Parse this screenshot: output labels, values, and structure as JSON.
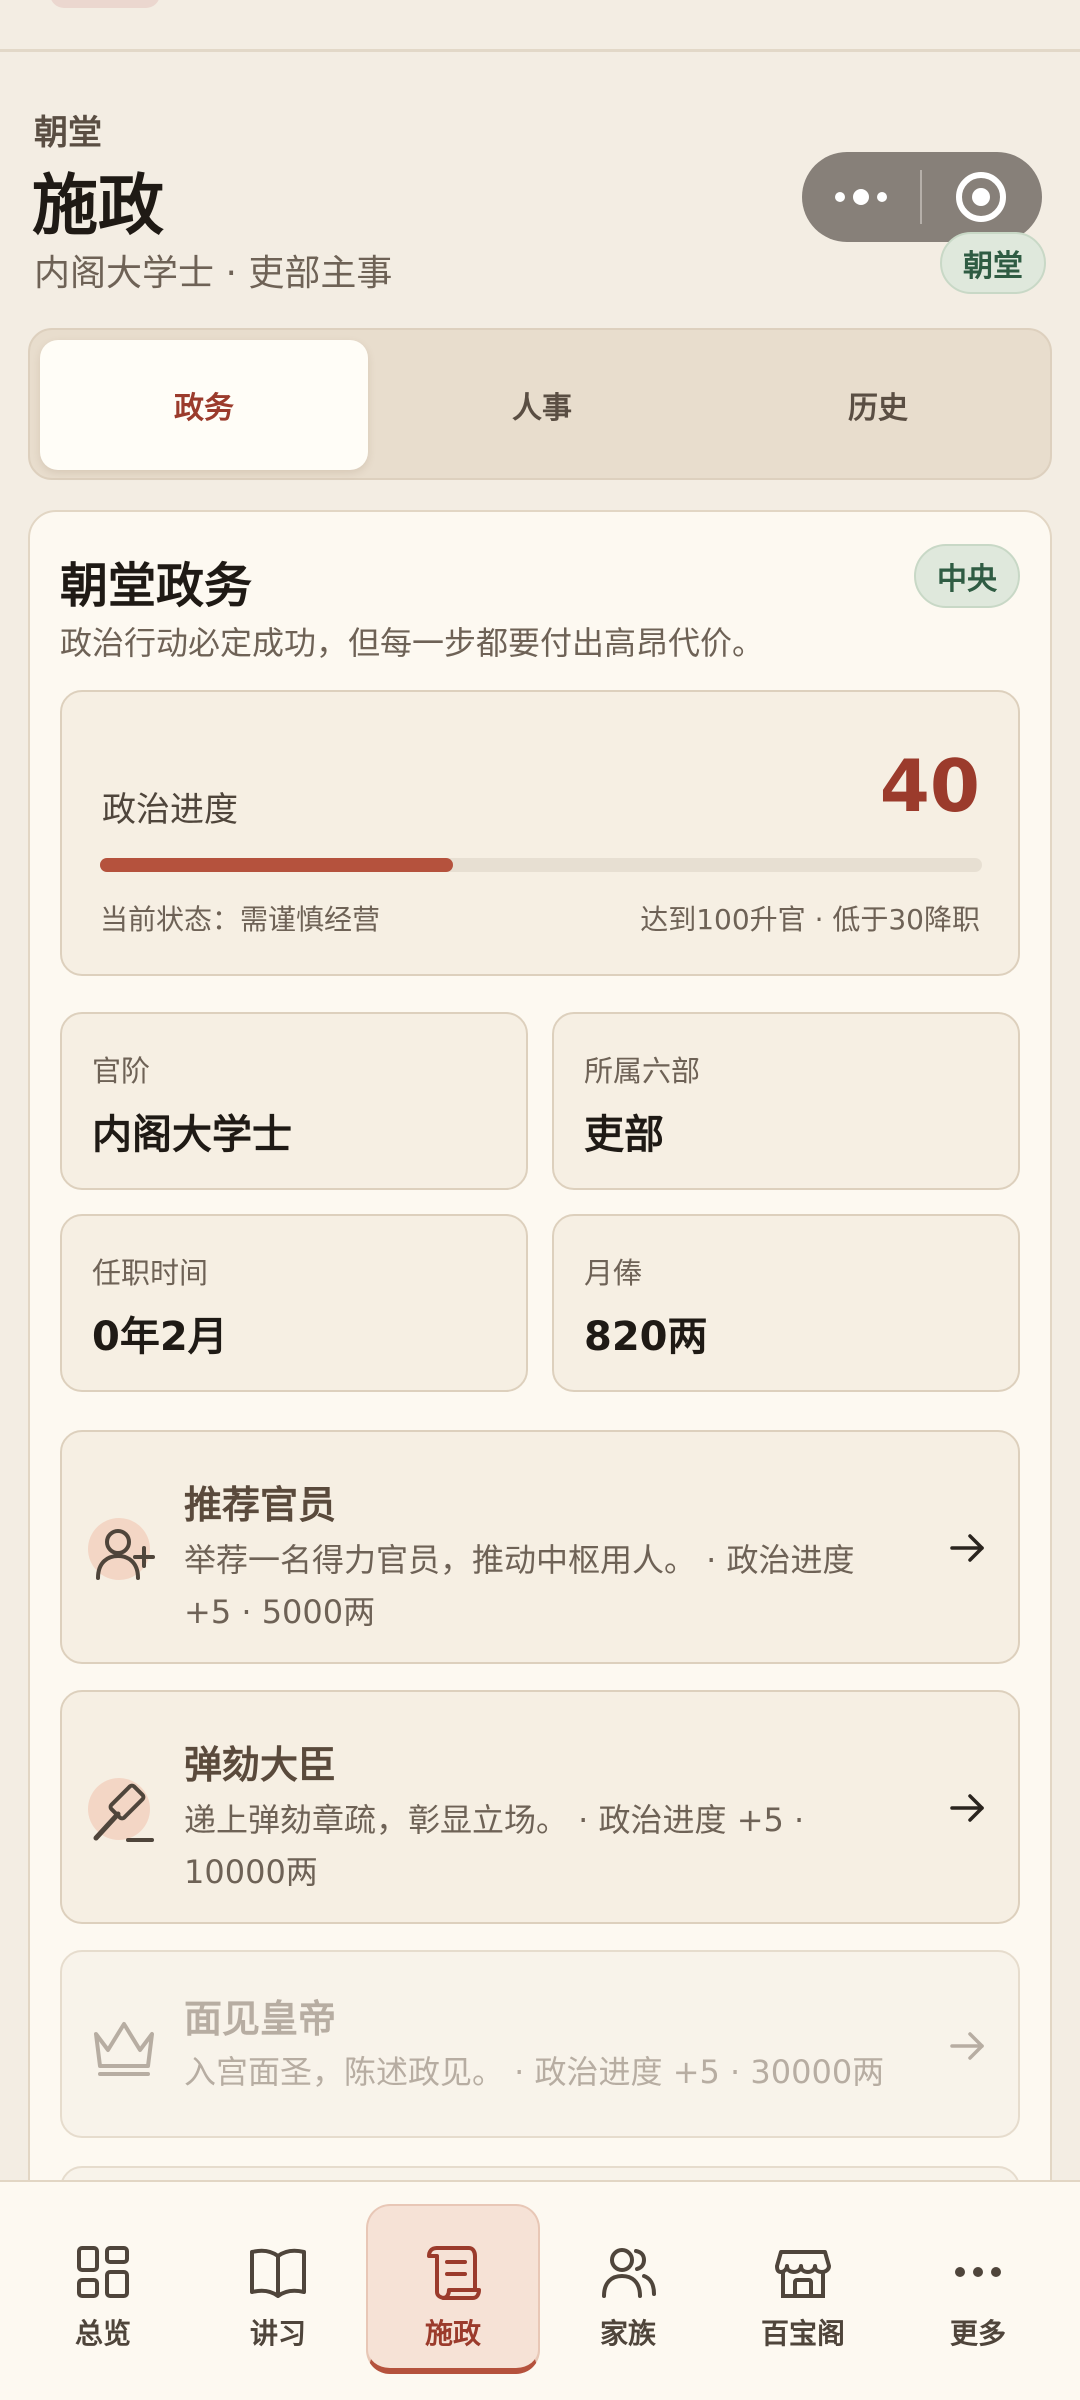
{
  "header": {
    "kicker": "朝堂",
    "title": "施政",
    "subtitle": "内阁大学士 · 吏部主事",
    "badge": "朝堂"
  },
  "tabs": [
    {
      "label": "政务",
      "active": true
    },
    {
      "label": "人事",
      "active": false
    },
    {
      "label": "历史",
      "active": false
    }
  ],
  "card": {
    "title": "朝堂政务",
    "subtitle": "政治行动必定成功，但每一步都要付出高昂代价。",
    "badge": "中央"
  },
  "progress": {
    "label": "政治进度",
    "value": "40",
    "percent": 40,
    "status": "当前状态：需谨慎经营",
    "rule": "达到100升官 · 低于30降职"
  },
  "stats": [
    {
      "label": "官阶",
      "value": "内阁大学士"
    },
    {
      "label": "所属六部",
      "value": "吏部"
    },
    {
      "label": "任职时间",
      "value": "0年2月"
    },
    {
      "label": "月俸",
      "value": "820两"
    }
  ],
  "actions": [
    {
      "title": "推荐官员",
      "desc": "举荐一名得力官员，推动中枢用人。 · 政治进度 +5 · 5000两",
      "icon": "user-plus-icon",
      "disabled": false
    },
    {
      "title": "弹劾大臣",
      "desc": "递上弹劾章疏，彰显立场。 · 政治进度 +5 · 10000两",
      "icon": "gavel-icon",
      "disabled": false
    },
    {
      "title": "面见皇帝",
      "desc": "入宫面圣，陈述政见。 · 政治进度 +5 · 30000两",
      "icon": "crown-icon",
      "disabled": true
    }
  ],
  "nav": [
    {
      "label": "总览",
      "icon": "grid-icon",
      "active": false
    },
    {
      "label": "讲习",
      "icon": "book-icon",
      "active": false
    },
    {
      "label": "施政",
      "icon": "scroll-icon",
      "active": true
    },
    {
      "label": "家族",
      "icon": "people-icon",
      "active": false
    },
    {
      "label": "百宝阁",
      "icon": "shop-icon",
      "active": false
    },
    {
      "label": "更多",
      "icon": "more-icon",
      "active": false
    }
  ],
  "colors": {
    "accent": "#9b3b2c",
    "progress_fill": "#b5523d",
    "badge_green": "#2f5c43",
    "background": "#f3ede3"
  }
}
